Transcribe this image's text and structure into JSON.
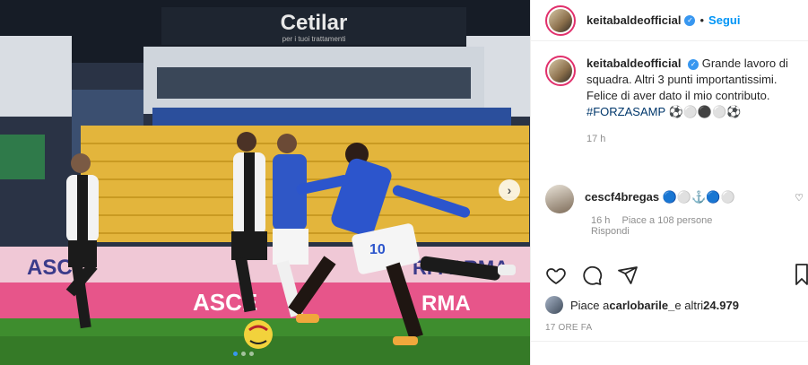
{
  "post": {
    "username": "keitabaldeofficial",
    "follow_label": "Segui",
    "separator": "•"
  },
  "caption": {
    "username": "keitabaldeofficial",
    "text": "Grande lavoro di squadra. Altri 3 punti importantissimi. Felice di aver dato il mio contributo.",
    "hashtag": "#FORZASAMP",
    "emoji": "⚽⚪⚫⚪⚽",
    "time": "17 h"
  },
  "comment": {
    "username": "cescf4bregas",
    "text": "🔵⚪⚓🔵⚪",
    "time": "16 h",
    "likes": "Piace a 108 persone",
    "reply": "Rispondi"
  },
  "likes": {
    "prefix": "Piace a ",
    "user": "carlobarile_",
    "suffix": " e altri ",
    "count": "24.979"
  },
  "timestamp": "17 ORE FA",
  "photo": {
    "banner_top": "Cetilar",
    "banner_sub": "per i tuoi trattamenti",
    "board_text_1": "ASC",
    "board_text_2": "RI PARMA",
    "board_text_3": "ASCE",
    "board_text_4": "RMA",
    "jersey_number": "10",
    "sponsor": "Cetilar"
  },
  "colors": {
    "accent": "#0095f6",
    "verified": "#3897f0",
    "ring": "#e1306c",
    "hashtag": "#00376b",
    "muted": "#8e8e8e"
  },
  "carousel": {
    "slides": 3,
    "active": 1
  }
}
